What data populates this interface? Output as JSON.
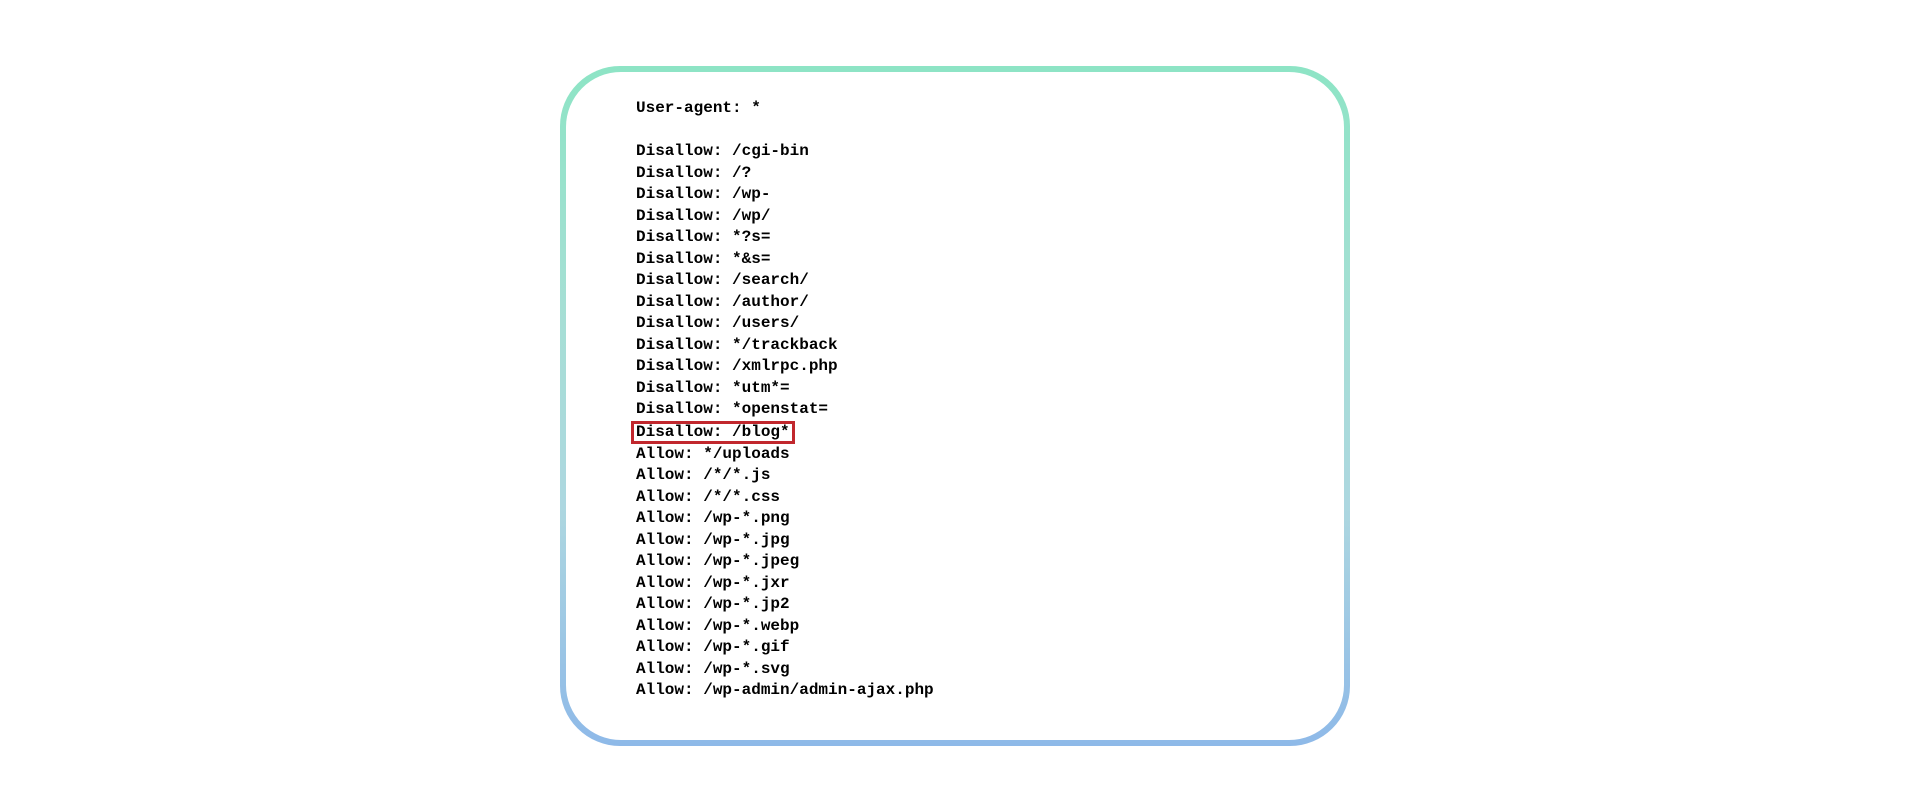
{
  "robots": {
    "lines": [
      "User-agent: *",
      "",
      "Disallow: /cgi-bin",
      "Disallow: /?",
      "Disallow: /wp-",
      "Disallow: /wp/",
      "Disallow: *?s=",
      "Disallow: *&s=",
      "Disallow: /search/",
      "Disallow: /author/",
      "Disallow: /users/",
      "Disallow: */trackback",
      "Disallow: /xmlrpc.php",
      "Disallow: *utm*=",
      "Disallow: *openstat=",
      "Disallow: /blog*",
      "Allow: */uploads",
      "Allow: /*/*.js",
      "Allow: /*/*.css",
      "Allow: /wp-*.png",
      "Allow: /wp-*.jpg",
      "Allow: /wp-*.jpeg",
      "Allow: /wp-*.jxr",
      "Allow: /wp-*.jp2",
      "Allow: /wp-*.webp",
      "Allow: /wp-*.gif",
      "Allow: /wp-*.svg",
      "Allow: /wp-admin/admin-ajax.php"
    ],
    "highlighted_index": 15
  }
}
